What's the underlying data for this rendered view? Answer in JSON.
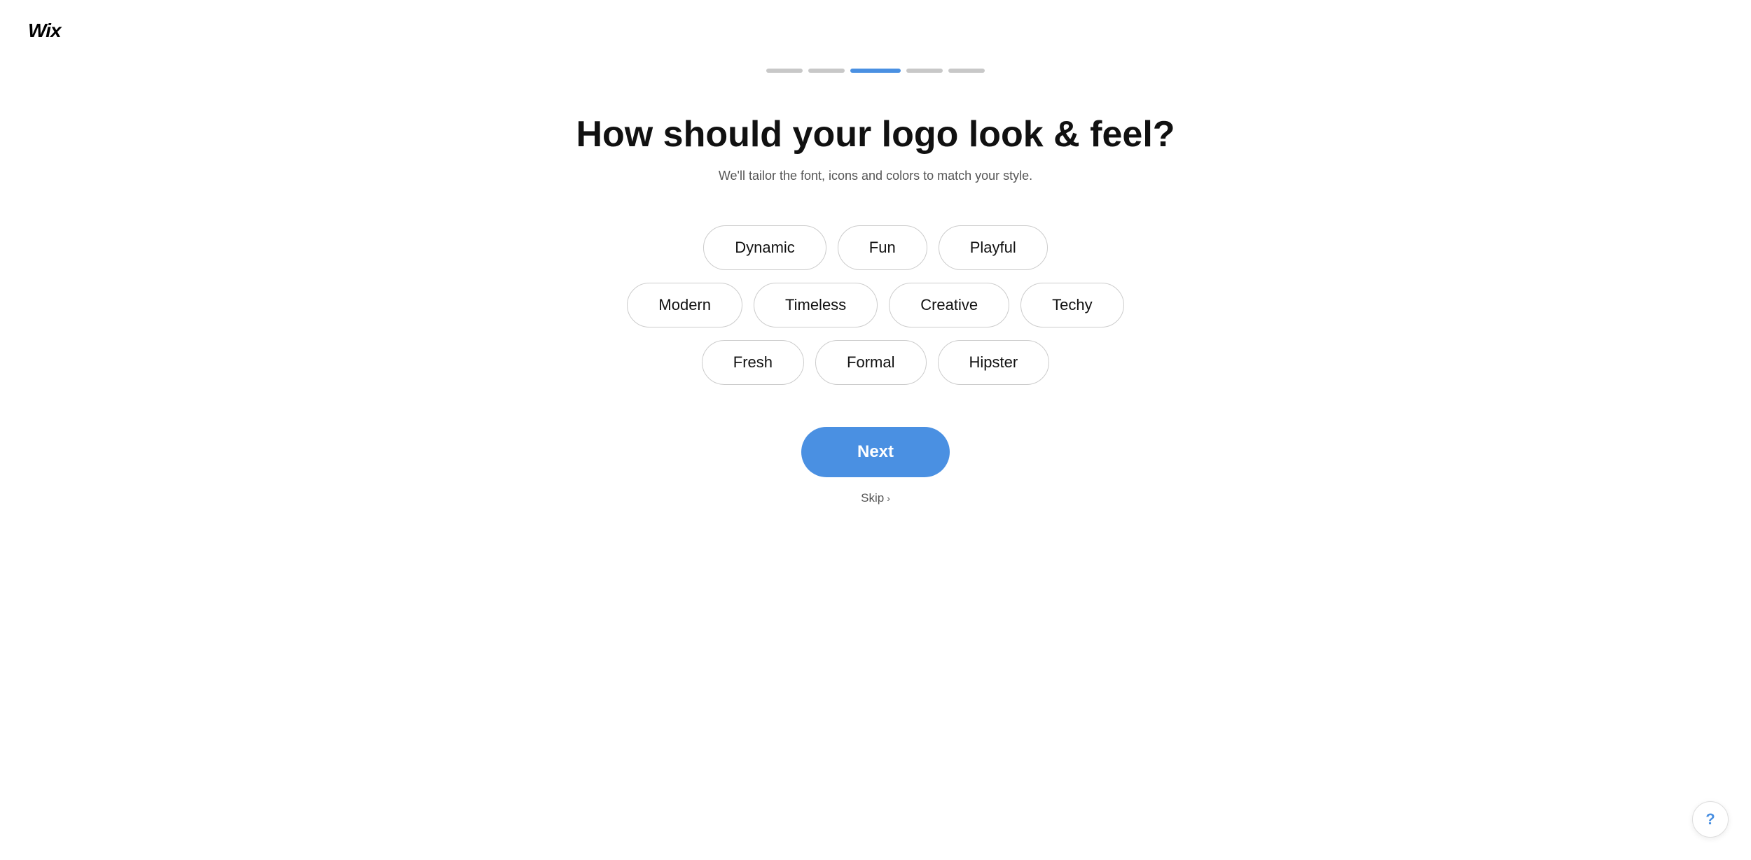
{
  "logo": {
    "text": "Wix"
  },
  "progress": {
    "steps": [
      {
        "id": 1,
        "state": "inactive"
      },
      {
        "id": 2,
        "state": "inactive"
      },
      {
        "id": 3,
        "state": "active"
      },
      {
        "id": 4,
        "state": "inactive"
      },
      {
        "id": 5,
        "state": "inactive"
      }
    ]
  },
  "header": {
    "title": "How should your logo look & feel?",
    "subtitle": "We'll tailor the font, icons and colors to match your style."
  },
  "style_options": {
    "rows": [
      {
        "id": "row1",
        "items": [
          {
            "id": "dynamic",
            "label": "Dynamic",
            "selected": false
          },
          {
            "id": "fun",
            "label": "Fun",
            "selected": false
          },
          {
            "id": "playful",
            "label": "Playful",
            "selected": false
          }
        ]
      },
      {
        "id": "row2",
        "items": [
          {
            "id": "modern",
            "label": "Modern",
            "selected": false
          },
          {
            "id": "timeless",
            "label": "Timeless",
            "selected": false
          },
          {
            "id": "creative",
            "label": "Creative",
            "selected": false
          },
          {
            "id": "techy",
            "label": "Techy",
            "selected": false
          }
        ]
      },
      {
        "id": "row3",
        "items": [
          {
            "id": "fresh",
            "label": "Fresh",
            "selected": false
          },
          {
            "id": "formal",
            "label": "Formal",
            "selected": false
          },
          {
            "id": "hipster",
            "label": "Hipster",
            "selected": false
          }
        ]
      }
    ]
  },
  "actions": {
    "next_label": "Next",
    "skip_label": "Skip"
  },
  "help": {
    "icon": "?"
  },
  "colors": {
    "accent": "#4a90e2",
    "progress_active": "#4a90e2",
    "progress_inactive": "#c8c8c8"
  }
}
